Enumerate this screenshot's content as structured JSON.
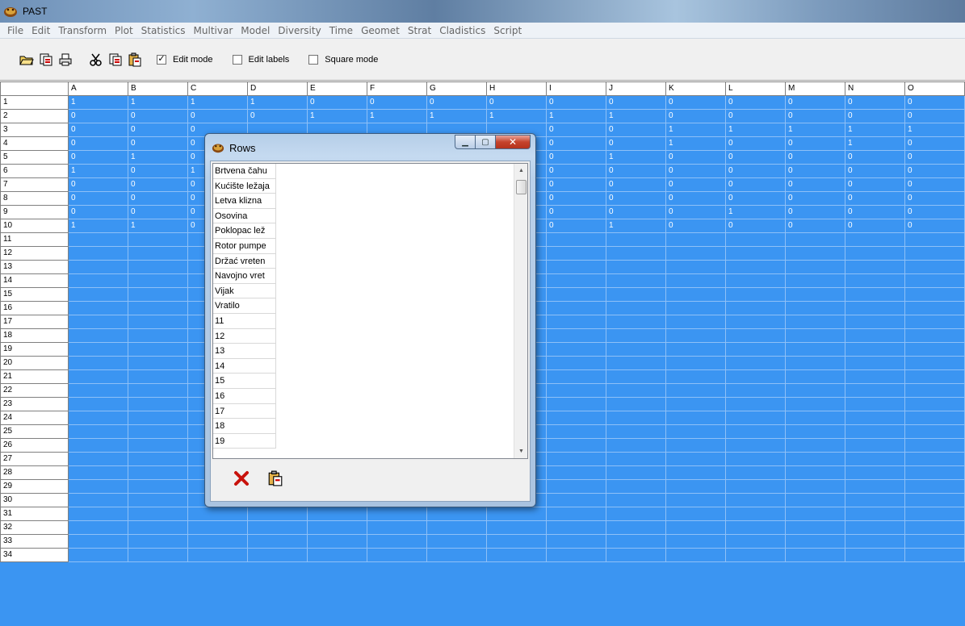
{
  "window": {
    "title": "PAST"
  },
  "menu": [
    "File",
    "Edit",
    "Transform",
    "Plot",
    "Statistics",
    "Multivar",
    "Model",
    "Diversity",
    "Time",
    "Geomet",
    "Strat",
    "Cladistics",
    "Script"
  ],
  "toolbar": {
    "open_icon": "folder-open-icon",
    "save_icon": "save-icon",
    "print_icon": "print-icon",
    "cut_icon": "cut-icon",
    "copy_icon": "copy-icon",
    "paste_icon": "paste-icon",
    "edit_mode": {
      "label": "Edit mode",
      "checked": true
    },
    "edit_labels": {
      "label": "Edit labels",
      "checked": false
    },
    "square_mode": {
      "label": "Square mode",
      "checked": false
    }
  },
  "sheet": {
    "columns": [
      "A",
      "B",
      "C",
      "D",
      "E",
      "F",
      "G",
      "H",
      "I",
      "J",
      "K",
      "L",
      "M",
      "N",
      "O"
    ],
    "row_labels": [
      "1",
      "2",
      "3",
      "4",
      "5",
      "6",
      "7",
      "8",
      "9",
      "10",
      "11",
      "12",
      "13",
      "14",
      "15",
      "16",
      "17",
      "18",
      "19",
      "20",
      "21",
      "22",
      "23",
      "24",
      "25",
      "26",
      "27",
      "28",
      "29",
      "30",
      "31",
      "32",
      "33",
      "34"
    ],
    "cells": [
      [
        "1",
        "1",
        "1",
        "1",
        "0",
        "0",
        "0",
        "0",
        "0",
        "0",
        "0",
        "0",
        "0",
        "0",
        "0"
      ],
      [
        "0",
        "0",
        "0",
        "0",
        "1",
        "1",
        "1",
        "1",
        "1",
        "1",
        "0",
        "0",
        "0",
        "0",
        "0"
      ],
      [
        "0",
        "0",
        "0",
        "",
        "",
        "",
        "",
        "",
        "0",
        "0",
        "1",
        "1",
        "1",
        "1",
        "1"
      ],
      [
        "0",
        "0",
        "0",
        "",
        "",
        "",
        "",
        "",
        "0",
        "0",
        "1",
        "0",
        "0",
        "1",
        "0"
      ],
      [
        "0",
        "1",
        "0",
        "",
        "",
        "",
        "",
        "",
        "0",
        "1",
        "0",
        "0",
        "0",
        "0",
        "0"
      ],
      [
        "1",
        "0",
        "1",
        "",
        "",
        "",
        "",
        "",
        "0",
        "0",
        "0",
        "0",
        "0",
        "0",
        "0"
      ],
      [
        "0",
        "0",
        "0",
        "",
        "",
        "",
        "",
        "",
        "0",
        "0",
        "0",
        "0",
        "0",
        "0",
        "0"
      ],
      [
        "0",
        "0",
        "0",
        "",
        "",
        "",
        "",
        "",
        "0",
        "0",
        "0",
        "0",
        "0",
        "0",
        "0"
      ],
      [
        "0",
        "0",
        "0",
        "",
        "",
        "",
        "",
        "",
        "0",
        "0",
        "0",
        "1",
        "0",
        "0",
        "0"
      ],
      [
        "1",
        "1",
        "0",
        "",
        "",
        "",
        "",
        "",
        "0",
        "1",
        "0",
        "0",
        "0",
        "0",
        "0"
      ]
    ]
  },
  "dialog": {
    "title": "Rows",
    "items": [
      "Brtvena čahu",
      "Kućište ležaja",
      "Letva klizna",
      "Osovina",
      "Poklopac lež",
      "Rotor pumpe",
      "Držać vreten",
      "Navojno vret",
      "Vijak",
      "Vratilo",
      "11",
      "12",
      "13",
      "14",
      "15",
      "16",
      "17",
      "18",
      "19"
    ],
    "cancel_icon": "close-x-icon",
    "apply_icon": "paste-apply-icon"
  }
}
